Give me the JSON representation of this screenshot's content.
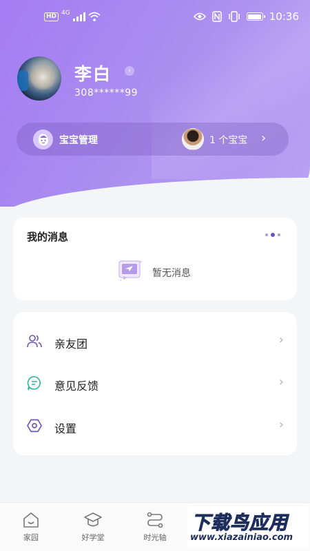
{
  "status_bar": {
    "hd": "HD",
    "network": "4G",
    "time": "10:36"
  },
  "profile": {
    "name": "李白",
    "phone": "308******99"
  },
  "baby_bar": {
    "label": "宝宝管理",
    "count_text": "1 个宝宝"
  },
  "messages": {
    "title": "我的消息",
    "empty_text": "暂无消息"
  },
  "menu": {
    "items": [
      {
        "label": "亲友团",
        "icon": "family-group-icon"
      },
      {
        "label": "意见反馈",
        "icon": "feedback-icon"
      },
      {
        "label": "设置",
        "icon": "settings-icon"
      }
    ]
  },
  "bottom_nav": {
    "items": [
      {
        "label": "家园",
        "icon": "home-icon"
      },
      {
        "label": "好学堂",
        "icon": "graduation-cap-icon"
      },
      {
        "label": "时光轴",
        "icon": "timeline-icon"
      }
    ]
  },
  "watermark": {
    "main": "下载鸟应用",
    "sub": "www.xiazainiao.com"
  },
  "colors": {
    "header": "#a57cf2",
    "accent": "#6d55b8",
    "background": "#f4f5f7"
  }
}
